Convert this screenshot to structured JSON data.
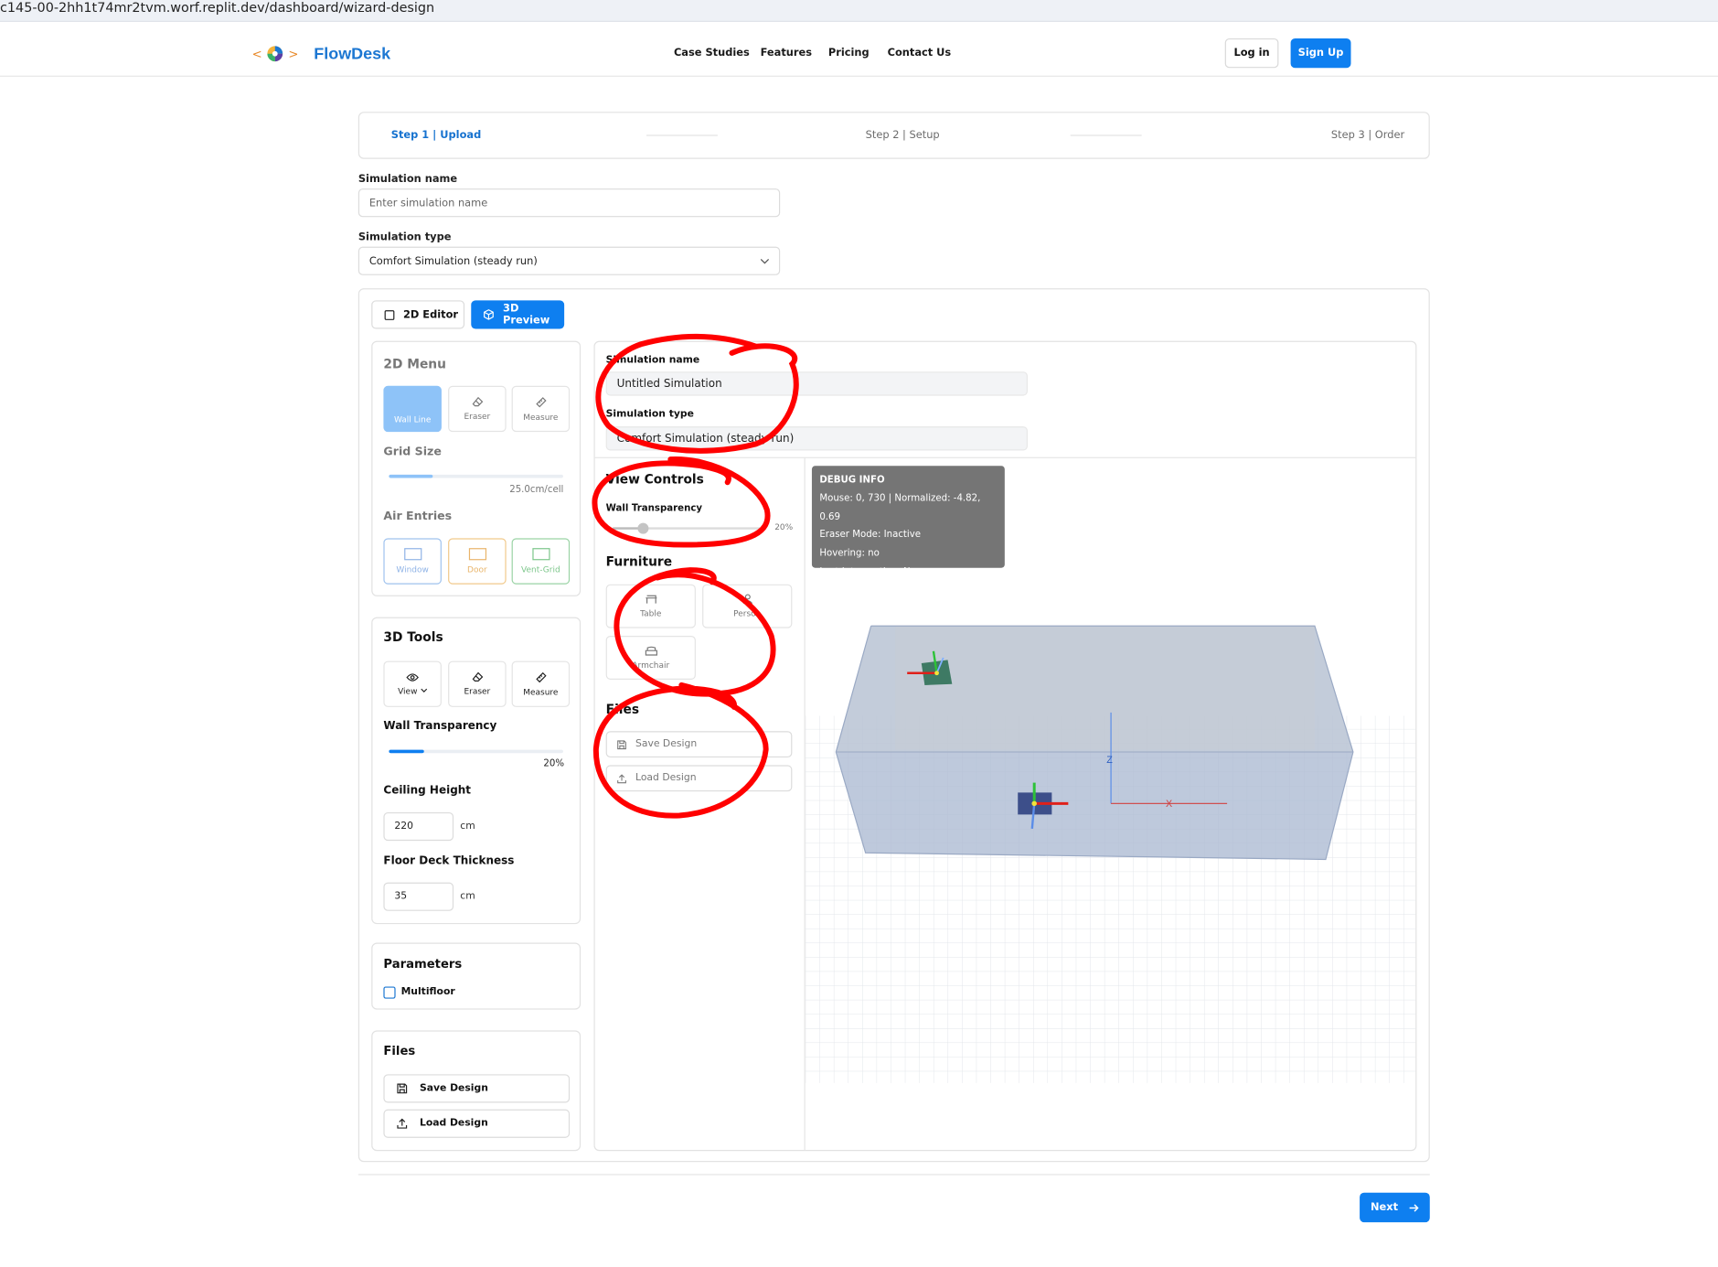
{
  "browser": {
    "url": "c145-00-2hh1t74mr2tvm.worf.replit.dev/dashboard/wizard-design"
  },
  "header": {
    "brand": "FlowDesk",
    "nav": [
      "Case Studies",
      "Features",
      "Pricing",
      "Contact Us"
    ],
    "login": "Log in",
    "signup": "Sign Up"
  },
  "steps": [
    "Step 1 | Upload",
    "Step 2 | Setup",
    "Step 3 | Order"
  ],
  "form": {
    "name_label": "Simulation name",
    "name_placeholder": "Enter simulation name",
    "type_label": "Simulation type",
    "type_value": "Comfort Simulation (steady run)"
  },
  "tabs": {
    "editor": "2D Editor",
    "preview": "3D Preview"
  },
  "menu2d": {
    "title": "2D Menu",
    "tools": [
      "Wall Line",
      "Eraser",
      "Measure"
    ],
    "grid_title": "Grid Size",
    "grid_value": "25.0cm/cell",
    "grid_fraction": 0.25,
    "air_title": "Air Entries",
    "air": [
      "Window",
      "Door",
      "Vent-Grid"
    ]
  },
  "tools3d": {
    "title": "3D Tools",
    "tools": [
      "View",
      "Eraser",
      "Measure"
    ],
    "transparency_title": "Wall Transparency",
    "transparency_value": "20%",
    "transparency_fraction": 0.2,
    "ceiling_title": "Ceiling Height",
    "ceiling_value": "220",
    "floor_title": "Floor Deck Thickness",
    "floor_value": "35",
    "unit": "cm"
  },
  "parameters": {
    "title": "Parameters",
    "multifloor": "Multifloor"
  },
  "files": {
    "title": "Files",
    "save": "Save Design",
    "load": "Load Design"
  },
  "preview": {
    "name_label": "Simulation name",
    "name_value": "Untitled Simulation",
    "type_label": "Simulation type",
    "type_value": "Comfort Simulation (steady run)",
    "view_title": "View Controls",
    "transparency_label": "Wall Transparency",
    "transparency_value": "20%",
    "furniture_title": "Furniture",
    "furniture": [
      "Table",
      "Person",
      "Armchair"
    ],
    "files_title": "Files",
    "save": "Save Design",
    "load": "Load Design"
  },
  "debug": {
    "title": "DEBUG INFO",
    "lines": [
      "Mouse: 0, 730 | Normalized: -4.82, 0.69",
      "Eraser Mode: Inactive",
      "Hovering: no",
      "Last Intersection: None"
    ]
  },
  "axes": {
    "x": "X",
    "z": "Z"
  },
  "footer": {
    "next": "Next"
  },
  "colors": {
    "primary": "#0e7ff0",
    "annotation": "#ff0000",
    "debug_bg": "#757575"
  }
}
